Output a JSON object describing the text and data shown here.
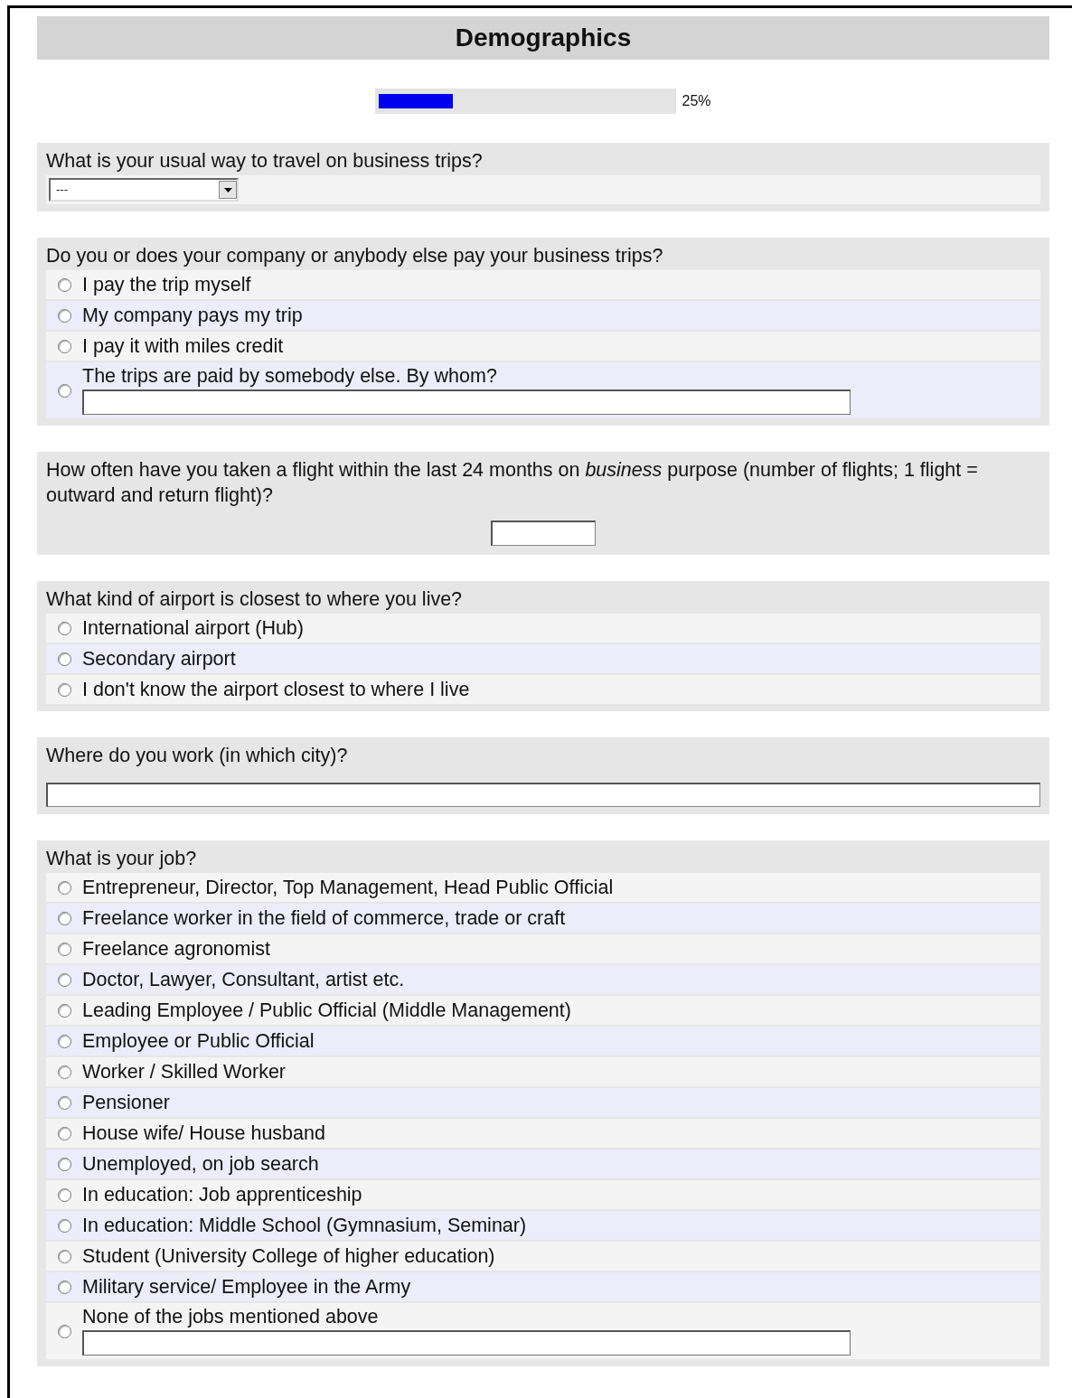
{
  "title": "Demographics",
  "progress": {
    "level": 0.25,
    "reading": "25%"
  },
  "questions": [
    {
      "kind": "select",
      "text": "What is your usual way to travel on business trips?",
      "value": "---"
    },
    {
      "kind": "radio",
      "text": "Do you or does your company or anybody else pay your business trips?",
      "options": [
        {
          "kind": "plain",
          "label": "I pay the trip myself",
          "selected": false
        },
        {
          "kind": "plain",
          "label": "My company pays my trip",
          "selected": false
        },
        {
          "kind": "plain",
          "label": "I pay it with miles credit",
          "selected": false
        },
        {
          "kind": "other",
          "label": "The trips are paid by somebody else. By whom?",
          "selected": false
        }
      ]
    },
    {
      "kind": "number",
      "text": "How often have you taken a flight within the last 24 months on *business* purpose (number of flights; 1 flight = outward and return flight)?"
    },
    {
      "kind": "radio",
      "text": "What kind of airport is closest to where you live?",
      "options": [
        {
          "kind": "plain",
          "label": "International airport (Hub)",
          "selected": false
        },
        {
          "kind": "plain",
          "label": "Secondary airport",
          "selected": false
        },
        {
          "kind": "plain",
          "label": "I don't know the airport closest to where I live",
          "selected": false
        }
      ]
    },
    {
      "kind": "text",
      "text": "Where do you work (in which city)?"
    },
    {
      "kind": "radio",
      "text": "What is your job?",
      "options": [
        {
          "kind": "plain",
          "label": "Entrepreneur, Director, Top Management, Head Public Official",
          "selected": false
        },
        {
          "kind": "plain",
          "label": "Freelance worker in the field of commerce, trade or craft",
          "selected": false
        },
        {
          "kind": "plain",
          "label": "Freelance agronomist",
          "selected": false
        },
        {
          "kind": "plain",
          "label": "Doctor, Lawyer, Consultant, artist etc.",
          "selected": false
        },
        {
          "kind": "plain",
          "label": "Leading Employee / Public Official (Middle Management)",
          "selected": false
        },
        {
          "kind": "plain",
          "label": "Employee or Public Official",
          "selected": false
        },
        {
          "kind": "plain",
          "label": "Worker / Skilled Worker",
          "selected": false
        },
        {
          "kind": "plain",
          "label": "Pensioner",
          "selected": false
        },
        {
          "kind": "plain",
          "label": "House wife/ House husband",
          "selected": false
        },
        {
          "kind": "plain",
          "label": "Unemployed, on job search",
          "selected": false
        },
        {
          "kind": "plain",
          "label": "In education: Job apprenticeship",
          "selected": false
        },
        {
          "kind": "plain",
          "label": "In education: Middle School (Gymnasium, Seminar)",
          "selected": false
        },
        {
          "kind": "plain",
          "label": "Student (University College of higher education)",
          "selected": false
        },
        {
          "kind": "plain",
          "label": "Military service/ Employee in the Army",
          "selected": false
        },
        {
          "kind": "other",
          "label": "None of the jobs mentioned above",
          "selected": false
        }
      ]
    }
  ]
}
